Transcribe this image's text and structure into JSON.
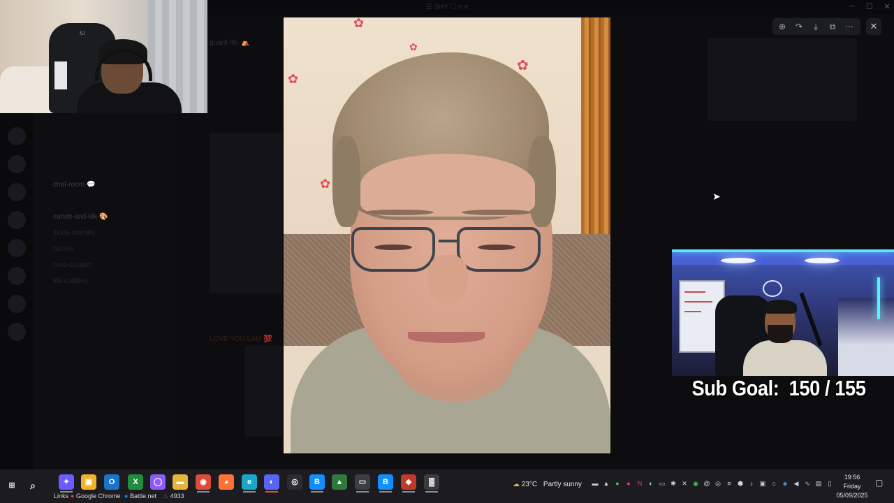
{
  "background_app": {
    "title": "☰ SHY ☐ ≡ ≡",
    "channels": [
      {
        "label": "chat-room-💬",
        "bright": true
      },
      {
        "label": "saheb-and-klk-🎨",
        "bright": true
      },
      {
        "label": "tiktok-memes",
        "bright": false
      },
      {
        "label": "hotties",
        "bright": false
      },
      {
        "label": "mod-support",
        "bright": false
      },
      {
        "label": "klk-cuddles",
        "bright": false
      }
    ],
    "message_header": "guard-life-⛺",
    "message_text": "LOVE YOU LAM 💯"
  },
  "viewer": {
    "toolbar": {
      "zoom_icon": "zoom-in-icon",
      "forward_icon": "forward-icon",
      "download_icon": "download-icon",
      "open_icon": "open-external-icon",
      "more_icon": "more-icon"
    },
    "close_label": "✕"
  },
  "overlay": {
    "sub_goal_label": "Sub Goal:",
    "sub_goal_current": 150,
    "sub_goal_target": 155,
    "sub_goal_text": "Sub Goal:  150 / 155",
    "webcam1_badge": "SJ"
  },
  "taskbar": {
    "start_icon": "windows-icon",
    "search_icon": "search-icon",
    "pinned_apps": [
      {
        "name": "copilot-icon",
        "color": "#6a5cff",
        "label": "✦"
      },
      {
        "name": "store-icon",
        "color": "#f0b429",
        "label": "▣"
      },
      {
        "name": "outlook-icon",
        "color": "#1a73c8",
        "label": "O"
      },
      {
        "name": "xbox-icon",
        "color": "#1e8e3e",
        "label": "X"
      },
      {
        "name": "app-circle-icon",
        "color": "#8b5cf6",
        "label": "◯"
      },
      {
        "name": "file-explorer-icon",
        "color": "#e8b53c",
        "label": "▬"
      },
      {
        "name": "chrome-icon",
        "color": "#dd4b39",
        "label": "◉"
      },
      {
        "name": "firefox-icon",
        "color": "#ff7139",
        "label": "◕"
      },
      {
        "name": "edge-icon",
        "color": "#1aa6c9",
        "label": "e"
      },
      {
        "name": "discord-icon",
        "color": "#5865f2",
        "label": "◐"
      },
      {
        "name": "obs-icon",
        "color": "#2b2b30",
        "label": "◎"
      },
      {
        "name": "battlenet-icon",
        "color": "#148eff",
        "label": "B"
      },
      {
        "name": "app-green-icon",
        "color": "#2d7a3b",
        "label": "▲"
      },
      {
        "name": "xbox-bar-icon",
        "color": "#3a3d44",
        "label": "▭"
      },
      {
        "name": "battlenet2-icon",
        "color": "#148eff",
        "label": "B"
      },
      {
        "name": "game-icon",
        "color": "#c0392b",
        "label": "◆"
      },
      {
        "name": "cod-icon",
        "color": "#3b3b3b",
        "label": "▓"
      }
    ],
    "links_label": "Links",
    "link_items": [
      {
        "icon": "chrome-icon",
        "label": "Google Chrome"
      },
      {
        "icon": "battlenet-icon",
        "label": "Battle.net"
      },
      {
        "icon": "flame-icon",
        "label": "4933"
      }
    ],
    "weather": {
      "icon": "partly-sunny-icon",
      "temp": "23°C",
      "desc": "Partly sunny"
    },
    "clock": {
      "time": "19:56",
      "day": "Friday",
      "date": "05/09/2025"
    },
    "notification_icon": "notification-icon"
  },
  "colors": {
    "accent_red": "#e8494a",
    "sub_goal_text": "#ffffff",
    "neon": "#58e8ff"
  }
}
